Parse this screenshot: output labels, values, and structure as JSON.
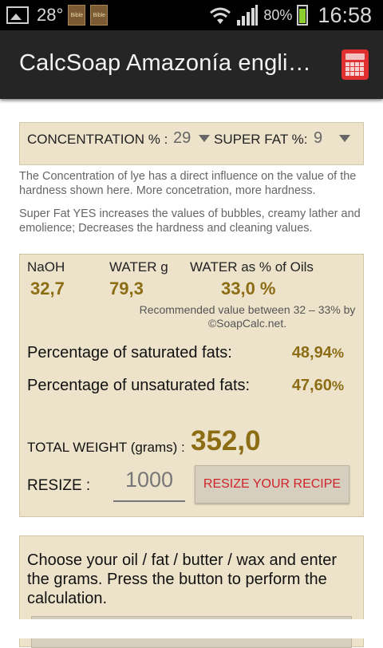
{
  "status_bar": {
    "temperature": "28°",
    "notification_icons": [
      "gallery-icon",
      "bible-icon",
      "bible-icon"
    ],
    "book_label": "Bible",
    "battery_percent": "80%",
    "battery_level": 0.8,
    "clock": "16:58"
  },
  "action_bar": {
    "title": "CalcSoap Amazonía engli…",
    "calculator_icon": "calculator-icon",
    "accent_color": "#e03030"
  },
  "concentration": {
    "label": "CONCENTRATION % :",
    "value": "29",
    "superfat_label": "SUPER FAT %:",
    "superfat_value": "9"
  },
  "notes": {
    "concentration_note": "The Concentration of lye has a direct influence on the value of the hardness shown here. More concetration, more hardness.",
    "superfat_note": "Super Fat YES increases the values of bubbles, creamy lather and emolience; Decreases the hardness and cleaning values."
  },
  "results": {
    "naoh_label": "NaOH",
    "naoh_value": "32,7",
    "water_label": "WATER g",
    "water_value": "79,3",
    "water_pct_label": "WATER as % of Oils",
    "water_pct_value": "33,0 %",
    "recommended_note": "Recommended value between 32 – 33% by ©SoapCalc.net.",
    "saturated_label": "Percentage of saturated fats:",
    "saturated_value": "48,94",
    "unsaturated_label": "Percentage of unsaturated fats:",
    "unsaturated_value": "47,60",
    "percent_sign": "%",
    "total_weight_label": "TOTAL WEIGHT (grams) :",
    "total_weight_value": "352,0",
    "resize_label": "RESIZE :",
    "resize_value": "1000",
    "resize_button": "RESIZE YOUR RECIPE"
  },
  "choose": {
    "instructions": "Choose your oil / fat / butter / wax and enter the grams. Press the button to perform the calculation."
  },
  "colors": {
    "panel_bg": "#ede3cb",
    "value_gold": "#8c6d14",
    "button_text_red": "#d0242a"
  }
}
